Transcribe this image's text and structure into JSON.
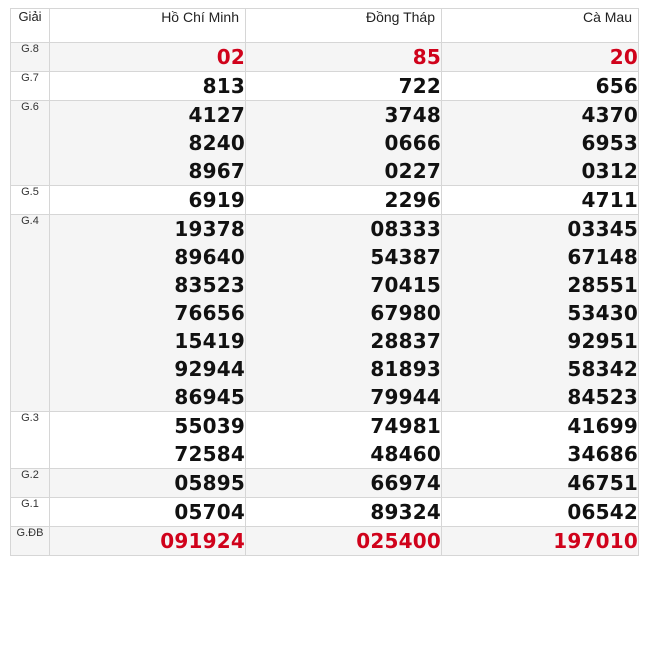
{
  "header": {
    "prize_label": "Giải",
    "provinces": [
      "Hồ Chí Minh",
      "Đồng Tháp",
      "Cà Mau"
    ]
  },
  "rows": [
    {
      "label": "G.8",
      "values": [
        [
          "02"
        ],
        [
          "85"
        ],
        [
          "20"
        ]
      ],
      "highlight": true
    },
    {
      "label": "G.7",
      "values": [
        [
          "813"
        ],
        [
          "722"
        ],
        [
          "656"
        ]
      ]
    },
    {
      "label": "G.6",
      "values": [
        [
          "4127",
          "8240",
          "8967"
        ],
        [
          "3748",
          "0666",
          "0227"
        ],
        [
          "4370",
          "6953",
          "0312"
        ]
      ]
    },
    {
      "label": "G.5",
      "values": [
        [
          "6919"
        ],
        [
          "2296"
        ],
        [
          "4711"
        ]
      ]
    },
    {
      "label": "G.4",
      "values": [
        [
          "19378",
          "89640",
          "83523",
          "76656",
          "15419",
          "92944",
          "86945"
        ],
        [
          "08333",
          "54387",
          "70415",
          "67980",
          "28837",
          "81893",
          "79944"
        ],
        [
          "03345",
          "67148",
          "28551",
          "53430",
          "92951",
          "58342",
          "84523"
        ]
      ]
    },
    {
      "label": "G.3",
      "values": [
        [
          "55039",
          "72584"
        ],
        [
          "74981",
          "48460"
        ],
        [
          "41699",
          "34686"
        ]
      ]
    },
    {
      "label": "G.2",
      "values": [
        [
          "05895"
        ],
        [
          "66974"
        ],
        [
          "46751"
        ]
      ]
    },
    {
      "label": "G.1",
      "values": [
        [
          "05704"
        ],
        [
          "89324"
        ],
        [
          "06542"
        ]
      ]
    },
    {
      "label": "G.ĐB",
      "values": [
        [
          "091924"
        ],
        [
          "025400"
        ],
        [
          "197010"
        ]
      ],
      "highlight": true
    }
  ],
  "colors": {
    "highlight": "#d0021b",
    "number": "#111111",
    "alt_row": "#f5f5f5",
    "border": "#d6d6d6"
  }
}
